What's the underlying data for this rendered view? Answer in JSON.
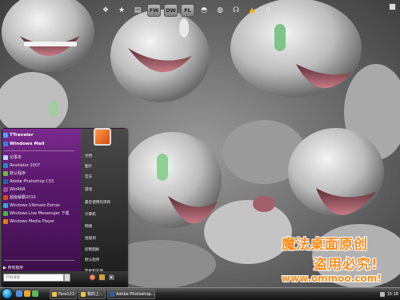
{
  "dock": {
    "icons": [
      {
        "name": "windows-icon",
        "glyph": "❖"
      },
      {
        "name": "star-icon",
        "glyph": "★"
      },
      {
        "name": "folder-icon",
        "glyph": "▤"
      },
      {
        "name": "fireworks-icon",
        "label": "FW"
      },
      {
        "name": "dreamweaver-icon",
        "label": "DW"
      },
      {
        "name": "flash-icon",
        "label": "FL"
      },
      {
        "name": "chat-icon",
        "glyph": "◓"
      },
      {
        "name": "globe-icon",
        "glyph": "◍"
      },
      {
        "name": "headphones-icon",
        "glyph": "☊"
      },
      {
        "name": "chart-icon",
        "glyph": "▲"
      },
      {
        "name": "trash-icon",
        "glyph": "▯"
      }
    ]
  },
  "start_menu": {
    "pinned": [
      {
        "label": "TTraveler",
        "color": "#4fa3ff"
      },
      {
        "label": "Windows Mail",
        "color": "#3e7be0"
      }
    ],
    "apps": [
      {
        "label": "记事本",
        "color": "#bcd4ef"
      },
      {
        "label": "Revelator 2007",
        "color": "#2e84c9"
      },
      {
        "label": "默认程序",
        "color": "#6fb84a"
      },
      {
        "label": "Adobe Photoshop CS3",
        "color": "#2d5fa3"
      },
      {
        "label": "WinRAR",
        "color": "#9a4fa0"
      },
      {
        "label": "超级解霸2010",
        "color": "#d8462c"
      },
      {
        "label": "Windows Ultimate Extras",
        "color": "#3aa1d8"
      },
      {
        "label": "Windows Live Messenger 下载",
        "color": "#4bb04b"
      },
      {
        "label": "Windows Media Player",
        "color": "#e07b1f"
      }
    ],
    "all_programs": "所有程序",
    "right_items": [
      "文档",
      "图片",
      "音乐",
      "游戏",
      "最近使用的项目",
      "计算机",
      "网络",
      "连接到",
      "控制面板",
      "默认程序",
      "帮助和支持"
    ],
    "search_placeholder": "开始搜索"
  },
  "watermark": {
    "line1": "魔法桌面原创",
    "line2": "盗用必究!",
    "line3": "www.ommoo.com!"
  },
  "taskbar": {
    "buttons": [
      {
        "label": "Faro123",
        "color": "#e8c54a"
      },
      {
        "label": "我的上...",
        "color": "#e8c54a"
      },
      {
        "label": "Adobe Photoshop...",
        "color": "#2d5fa3"
      }
    ],
    "clock": "15:18"
  },
  "colors": {
    "menu_purple": "#5b1a6d",
    "watermark_orange": "#ff8a16",
    "taskbar_dark": "#1e1e1e"
  }
}
